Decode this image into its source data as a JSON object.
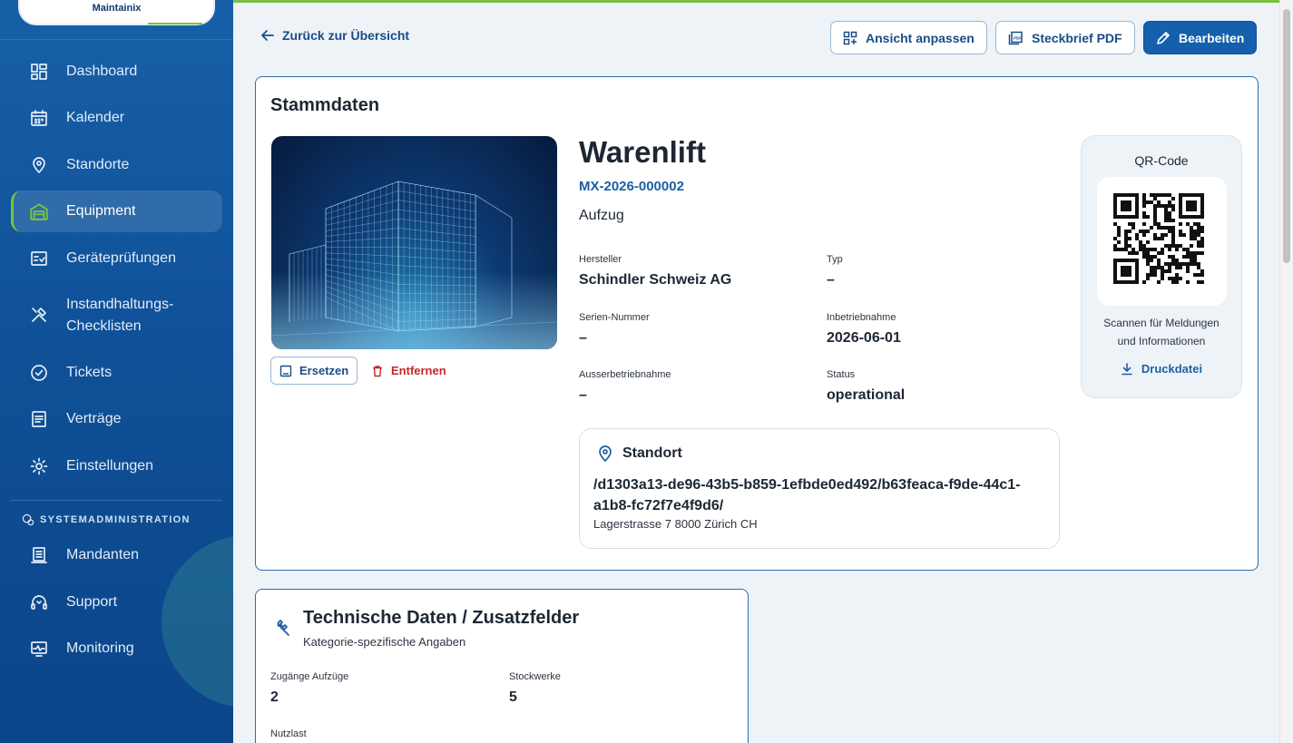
{
  "app": {
    "logo": "Maintainix"
  },
  "sidebar": {
    "items": [
      {
        "label": "Dashboard",
        "icon": "dashboard-icon"
      },
      {
        "label": "Kalender",
        "icon": "calendar-icon"
      },
      {
        "label": "Standorte",
        "icon": "location-pin-icon"
      },
      {
        "label": "Equipment",
        "icon": "garage-icon",
        "active": true
      },
      {
        "label": "Geräteprüfungen",
        "icon": "check-calendar-icon"
      },
      {
        "label": "Instandhaltungs-",
        "label2": "Checklisten",
        "icon": "tools-icon"
      },
      {
        "label": "Tickets",
        "icon": "check-circle-icon"
      },
      {
        "label": "Verträge",
        "icon": "document-icon"
      },
      {
        "label": "Einstellungen",
        "icon": "gear-icon"
      }
    ],
    "admin_section": "SYSTEMADMINISTRATION",
    "admin_items": [
      {
        "label": "Mandanten",
        "icon": "tenant-icon"
      },
      {
        "label": "Support",
        "icon": "headset-icon"
      },
      {
        "label": "Monitoring",
        "icon": "monitor-icon"
      }
    ]
  },
  "header": {
    "back_label": "Zurück zur Übersicht",
    "customize_label": "Ansicht anpassen",
    "pdf_label": "Steckbrief PDF",
    "edit_label": "Bearbeiten"
  },
  "stammdaten": {
    "section_title": "Stammdaten",
    "replace_label": "Ersetzen",
    "remove_label": "Entfernen",
    "name": "Warenlift",
    "code": "MX-2026-000002",
    "category": "Aufzug",
    "fields": {
      "hersteller_label": "Hersteller",
      "hersteller_value": "Schindler Schweiz AG",
      "typ_label": "Typ",
      "typ_value": "–",
      "serien_label": "Serien-Nummer",
      "serien_value": "–",
      "inbetrieb_label": "Inbetriebnahme",
      "inbetrieb_value": "2026-06-01",
      "ausser_label": "Ausserbetriebnahme",
      "ausser_value": "–",
      "status_label": "Status",
      "status_value": "operational"
    },
    "location": {
      "heading": "Standort",
      "path": "/d1303a13-de96-43b5-b859-1efbde0ed492/b63feaca-f9de-44c1-a1b8-fc72f7e4f9d6/",
      "address": "Lagerstrasse 7 8000 Zürich CH"
    },
    "qr": {
      "label": "QR-Code",
      "note_line1": "Scannen für Meldungen",
      "note_line2": "und Informationen",
      "download_label": "Druckdatei"
    }
  },
  "technical": {
    "title": "Technische Daten / Zusatzfelder",
    "subtitle": "Kategorie-spezifische Angaben",
    "zugaenge_label": "Zugänge Aufzüge",
    "zugaenge_value": "2",
    "stockwerke_label": "Stockwerke",
    "stockwerke_value": "5",
    "nutzlast_label": "Nutzlast"
  },
  "colors": {
    "primary": "#1560ad",
    "accent": "#7ac143",
    "danger": "#c62828",
    "sidebar": "#0f5198"
  }
}
